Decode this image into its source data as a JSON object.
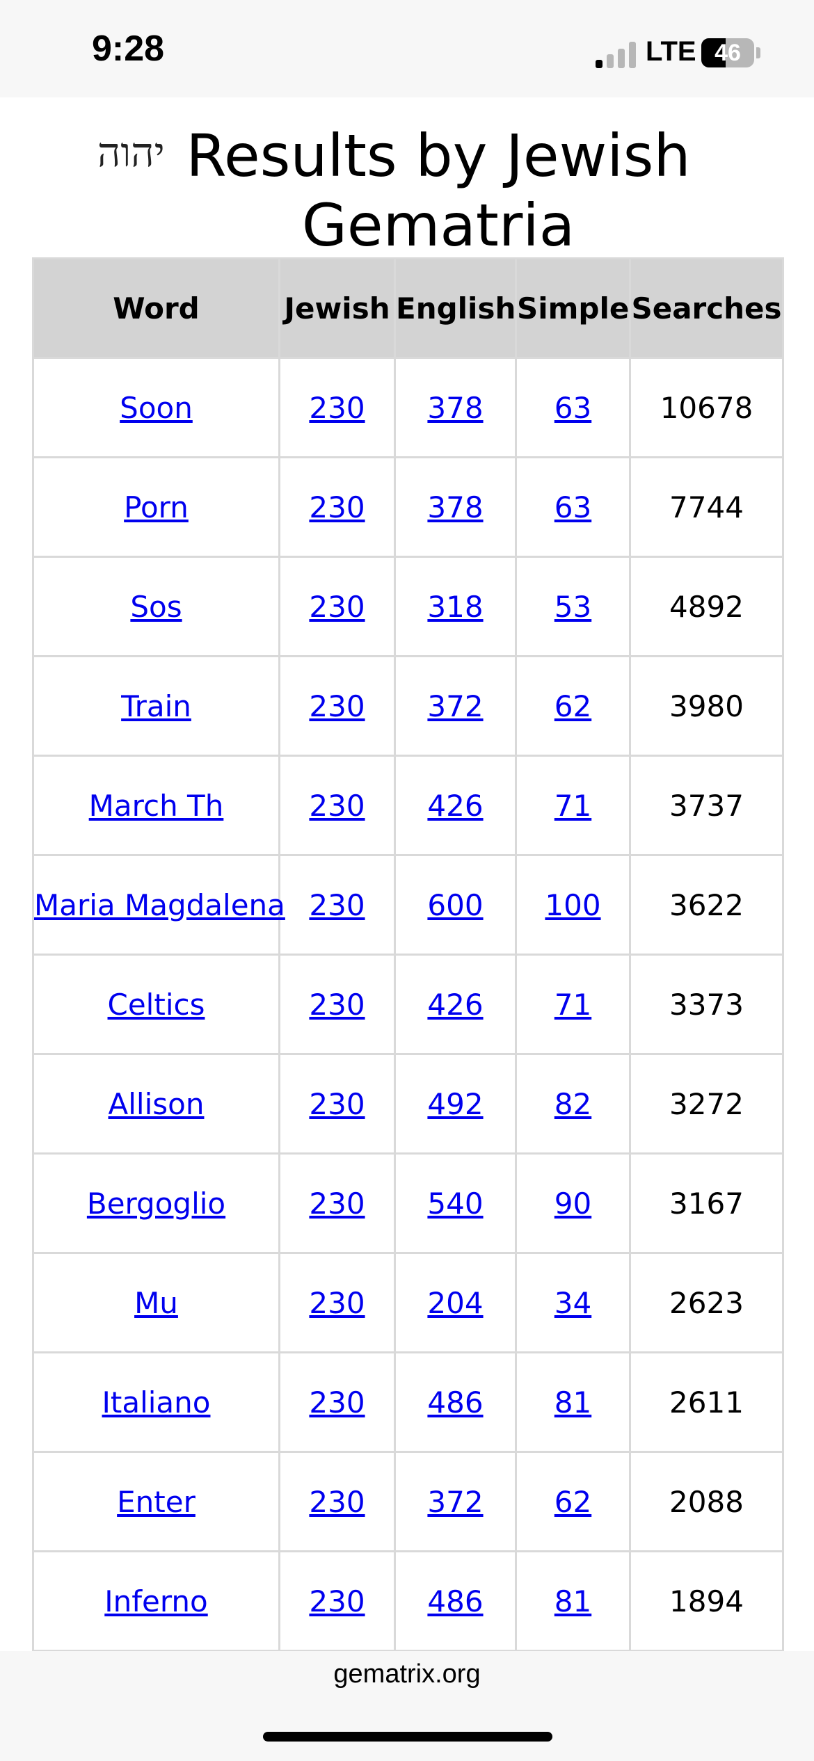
{
  "status_bar": {
    "time": "9:28",
    "network": "LTE",
    "battery_level": "46",
    "signal_bars_active": 1,
    "signal_bars_total": 4
  },
  "header": {
    "logo_text": "יהוה",
    "title": "Results by Jewish Gematria"
  },
  "table": {
    "columns": [
      "Word",
      "Jewish",
      "English",
      "Simple",
      "Searches"
    ],
    "rows": [
      {
        "word": "Soon",
        "jewish": "230",
        "english": "378",
        "simple": "63",
        "searches": "10678"
      },
      {
        "word": "Porn",
        "jewish": "230",
        "english": "378",
        "simple": "63",
        "searches": "7744"
      },
      {
        "word": "Sos",
        "jewish": "230",
        "english": "318",
        "simple": "53",
        "searches": "4892"
      },
      {
        "word": "Train",
        "jewish": "230",
        "english": "372",
        "simple": "62",
        "searches": "3980"
      },
      {
        "word": "March Th",
        "jewish": "230",
        "english": "426",
        "simple": "71",
        "searches": "3737"
      },
      {
        "word": "Maria Magdalena",
        "jewish": "230",
        "english": "600",
        "simple": "100",
        "searches": "3622"
      },
      {
        "word": "Celtics",
        "jewish": "230",
        "english": "426",
        "simple": "71",
        "searches": "3373"
      },
      {
        "word": "Allison",
        "jewish": "230",
        "english": "492",
        "simple": "82",
        "searches": "3272"
      },
      {
        "word": "Bergoglio",
        "jewish": "230",
        "english": "540",
        "simple": "90",
        "searches": "3167"
      },
      {
        "word": "Mu",
        "jewish": "230",
        "english": "204",
        "simple": "34",
        "searches": "2623"
      },
      {
        "word": "Italiano",
        "jewish": "230",
        "english": "486",
        "simple": "81",
        "searches": "2611"
      },
      {
        "word": "Enter",
        "jewish": "230",
        "english": "372",
        "simple": "62",
        "searches": "2088"
      },
      {
        "word": "Inferno",
        "jewish": "230",
        "english": "486",
        "simple": "81",
        "searches": "1894"
      }
    ]
  },
  "browser": {
    "url": "gematrix.org"
  },
  "colors": {
    "link": "#0000ee",
    "header_bg": "#d3d3d3",
    "border": "#d9d9d9"
  }
}
